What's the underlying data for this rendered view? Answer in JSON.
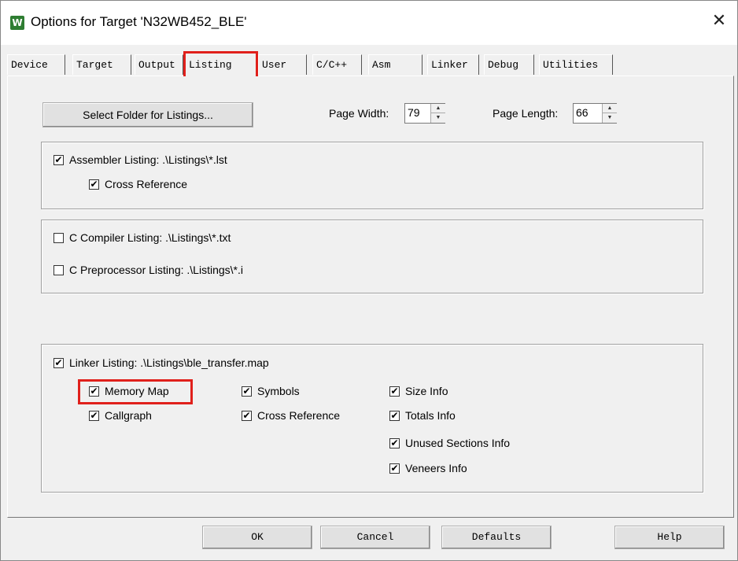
{
  "window": {
    "title": "Options for Target 'N32WB452_BLE'",
    "close_glyph": "✕",
    "app_icon": "W"
  },
  "tabs": [
    {
      "label": "Device"
    },
    {
      "label": "Target"
    },
    {
      "label": "Output"
    },
    {
      "label": "Listing",
      "active": true
    },
    {
      "label": "User"
    },
    {
      "label": "C/C++"
    },
    {
      "label": "Asm"
    },
    {
      "label": "Linker"
    },
    {
      "label": "Debug"
    },
    {
      "label": "Utilities"
    }
  ],
  "listing": {
    "select_folder_label": "Select Folder for Listings...",
    "page_width_label": "Page Width:",
    "page_width_value": "79",
    "page_length_label": "Page Length:",
    "page_length_value": "66",
    "assembler": {
      "label": "Assembler Listing:  .\\Listings\\*.lst",
      "checked": true,
      "cross_reference": {
        "label": "Cross Reference",
        "checked": true
      }
    },
    "c_compiler": {
      "label": "C Compiler Listing:  .\\Listings\\*.txt",
      "checked": false
    },
    "c_preprocessor": {
      "label": "C Preprocessor Listing:  .\\Listings\\*.i",
      "checked": false
    },
    "linker": {
      "label": "Linker Listing:  .\\Listings\\ble_transfer.map",
      "checked": true,
      "options": {
        "memory_map": {
          "label": "Memory Map",
          "checked": true
        },
        "callgraph": {
          "label": "Callgraph",
          "checked": true
        },
        "symbols": {
          "label": "Symbols",
          "checked": true
        },
        "cross_reference": {
          "label": "Cross Reference",
          "checked": true
        },
        "size_info": {
          "label": "Size Info",
          "checked": true
        },
        "totals_info": {
          "label": "Totals Info",
          "checked": true
        },
        "unused_sections_info": {
          "label": "Unused Sections Info",
          "checked": true
        },
        "veneers_info": {
          "label": "Veneers Info",
          "checked": true
        }
      }
    }
  },
  "buttons": {
    "ok": "OK",
    "cancel": "Cancel",
    "defaults": "Defaults",
    "help": "Help"
  },
  "check_glyph": "✔",
  "colors": {
    "highlight": "#e0201b",
    "dialog_bg": "#f0f0f0",
    "app_icon": "#2e7d32"
  }
}
